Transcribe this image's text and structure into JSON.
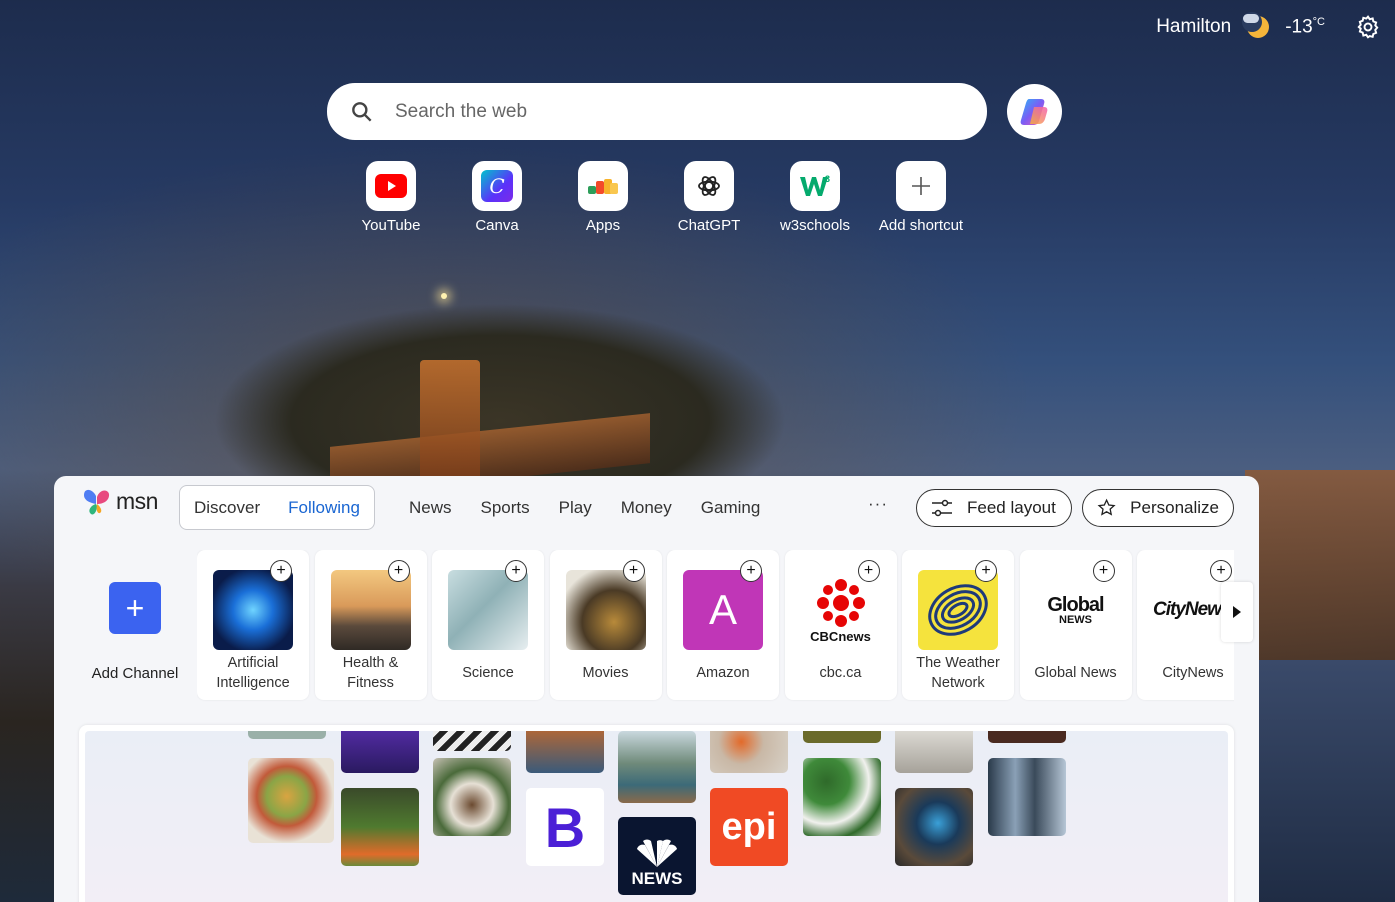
{
  "weather": {
    "city": "Hamilton",
    "temperature": "-13",
    "unit": "°C",
    "icon": "partly-cloudy-night-icon"
  },
  "search": {
    "placeholder": "Search the web"
  },
  "shortcuts": [
    {
      "label": "YouTube",
      "icon": "youtube-icon"
    },
    {
      "label": "Canva",
      "icon": "canva-icon"
    },
    {
      "label": "Apps",
      "icon": "apps-icon"
    },
    {
      "label": "ChatGPT",
      "icon": "chatgpt-icon"
    },
    {
      "label": "w3schools",
      "icon": "w3schools-icon"
    },
    {
      "label": "Add shortcut",
      "icon": "plus-icon"
    }
  ],
  "msn": {
    "logo": "msn",
    "tabs": [
      "Discover",
      "Following"
    ],
    "active_tab": "Following",
    "nav": [
      "News",
      "Sports",
      "Play",
      "Money",
      "Gaming"
    ],
    "more": "···",
    "feed_layout": "Feed layout",
    "personalize": "Personalize",
    "add_channel": "Add Channel",
    "channels": [
      {
        "label": "Artificial Intelligence",
        "icon": "ai-brain-icon"
      },
      {
        "label": "Health & Fitness",
        "icon": "fitness-icon"
      },
      {
        "label": "Science",
        "icon": "science-icon"
      },
      {
        "label": "Movies",
        "icon": "movies-icon"
      },
      {
        "label": "Amazon",
        "icon": "amazon-icon",
        "letter": "A"
      },
      {
        "label": "cbc.ca",
        "icon": "cbc-icon",
        "text": "CBCnews"
      },
      {
        "label": "The Weather Network",
        "icon": "weather-network-icon"
      },
      {
        "label": "Global News",
        "icon": "global-news-icon",
        "text": "Global",
        "subtext": "NEWS"
      },
      {
        "label": "CityNews",
        "icon": "citynews-icon",
        "text": "CityNews"
      }
    ],
    "collage": {
      "b_letter": "B",
      "epi_text": "epi",
      "nbc_text": "NEWS"
    }
  },
  "colors": {
    "accent": "#1a66d2",
    "add_channel": "#3b63f0",
    "amazon": "#c036b7",
    "epi": "#f04a24",
    "b_logo": "#4b1fd6"
  }
}
